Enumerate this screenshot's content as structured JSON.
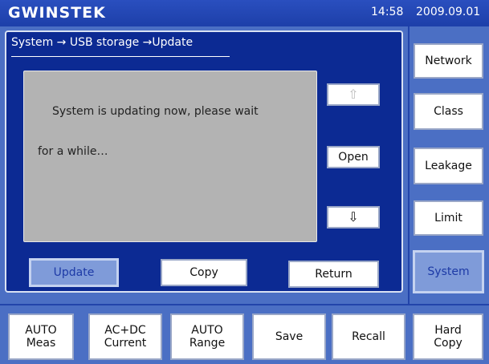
{
  "header": {
    "logo": "GWINSTEK",
    "time": "14:58",
    "date": "2009.09.01"
  },
  "breadcrumb": "System → USB storage →Update",
  "message": {
    "line1": "System is updating now, please wait",
    "line2": "for a while…"
  },
  "file_nav": {
    "up_icon": "⇧",
    "open_label": "Open",
    "down_icon": "⇩"
  },
  "actions": {
    "update": "Update",
    "copy": "Copy",
    "return": "Return"
  },
  "side_menu": {
    "network": "Network",
    "class": "Class",
    "leakage": "Leakage",
    "limit": "Limit",
    "system": "System"
  },
  "bottom_bar": {
    "auto_meas_1": "AUTO",
    "auto_meas_2": "Meas",
    "acdc_1": "AC+DC",
    "acdc_2": "Current",
    "auto_range_1": "AUTO",
    "auto_range_2": "Range",
    "save": "Save",
    "recall": "Recall",
    "hard_copy_1": "Hard",
    "hard_copy_2": "Copy"
  },
  "colors": {
    "background": "#4b6fc4",
    "panel": "#0c2a93",
    "selected_button": "#7f9bd9"
  }
}
